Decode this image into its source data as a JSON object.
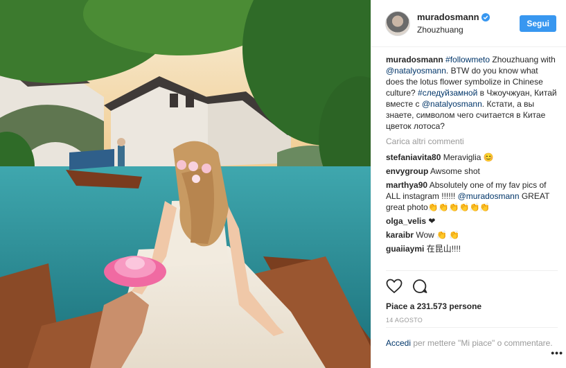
{
  "author": {
    "username": "muradosmann",
    "location": "Zhouzhuang",
    "follow_label": "Segui"
  },
  "caption": {
    "username": "muradosmann",
    "hashtag": "#followmeto",
    "text1": " Zhouzhuang with ",
    "mention": "@natalyosmann",
    "text2": ". BTW do you know what does the lotus flower symbolize in Chinese culture?",
    "hashtag_ru": "#следуйзамной",
    "text3": " в Чжоучжуан, Китай вместе с ",
    "mention2": "@natalyosmann",
    "text4": ". Кстати, а вы знаете, символом чего считается в Китае цветок лотоса?"
  },
  "load_more": "Carica altri commenti",
  "comments": [
    {
      "user": "stefaniavita80",
      "text": " Meraviglia 😊"
    },
    {
      "user": "envygroup",
      "text": " Awsome shot"
    },
    {
      "user": "marthya90",
      "text": " Absolutely one of my fav pics of ALL instagram !!!!!! ",
      "mention": "@muradosmann",
      "text2": " GREAT great photo👏👏👏👏👏👏"
    },
    {
      "user": "olga_velis",
      "text": " ❤"
    },
    {
      "user": "karaibr",
      "text": " Wow 👏 👏"
    },
    {
      "user": "guaiiaymi",
      "text": " 在昆山!!!!"
    }
  ],
  "likes_text": "Piace a 231.573 persone",
  "date": "14 AGOSTO",
  "login": {
    "link": "Accedi",
    "text": " per mettere \"Mi piace\" o commentare."
  },
  "more_options": "•••",
  "icons": [
    "heart-icon",
    "comment-icon",
    "verified-badge-icon"
  ],
  "colors": {
    "accent": "#3897f0",
    "link": "#003569",
    "muted": "#999999"
  }
}
